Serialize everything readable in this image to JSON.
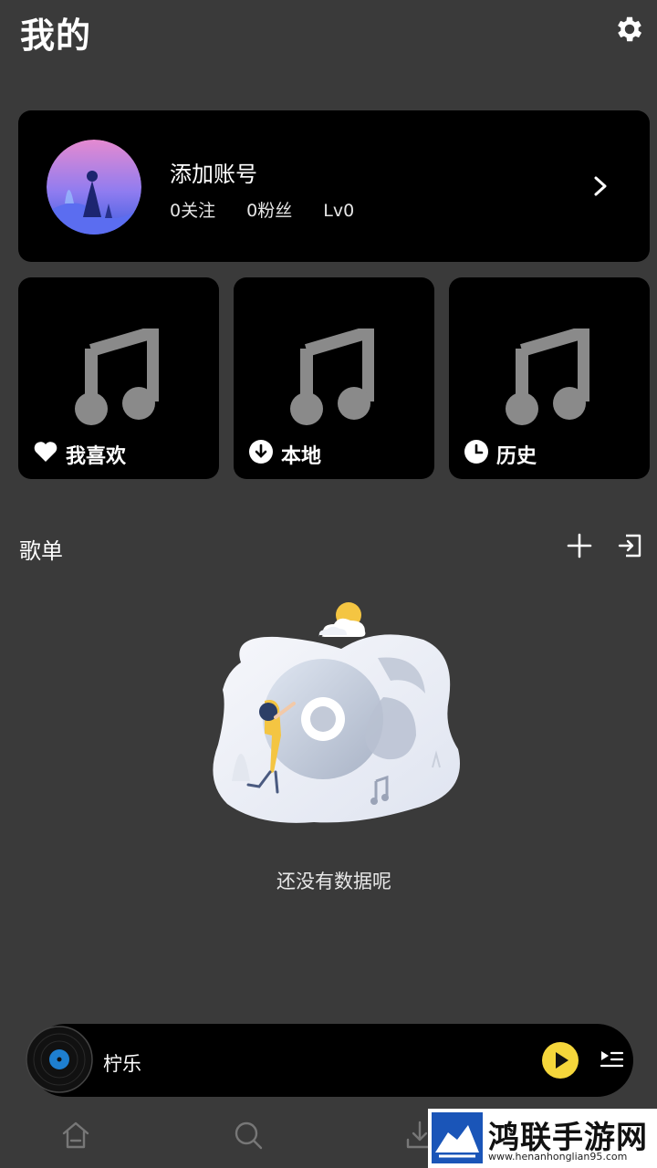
{
  "header": {
    "title": "我的",
    "settings_icon": "gear-icon"
  },
  "profile": {
    "name": "添加账号",
    "following": "0关注",
    "fans": "0粉丝",
    "level": "Lv0"
  },
  "tiles": [
    {
      "label": "我喜欢",
      "icon": "heart-icon"
    },
    {
      "label": "本地",
      "icon": "download-icon"
    },
    {
      "label": "历史",
      "icon": "clock-icon"
    }
  ],
  "playlists": {
    "title": "歌单",
    "empty_text": "还没有数据呢"
  },
  "player": {
    "song": "柠乐"
  },
  "nav": {
    "items": [
      "home-icon",
      "search-icon",
      "download-icon"
    ]
  },
  "watermark": {
    "title": "鸿联手游网",
    "url": "www.henanhonglian95.com"
  },
  "colors": {
    "background": "#3a3a3a",
    "card": "#000000",
    "accent_play": "#f5d63b"
  }
}
